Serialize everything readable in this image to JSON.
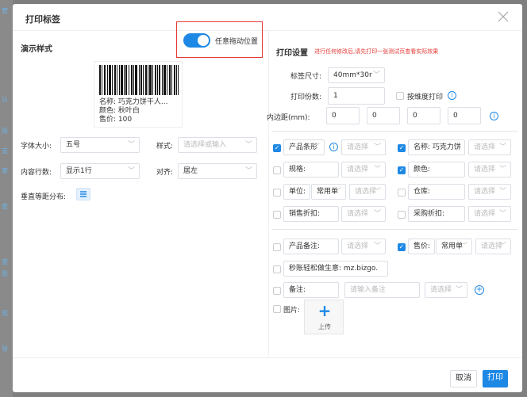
{
  "background_fragments": [
    "管",
    "认",
    "现",
    "支",
    "查",
    "查",
    "查",
    "现",
    "现",
    "导"
  ],
  "dialog": {
    "title": "打印标签",
    "close_icon": "close-icon"
  },
  "preview": {
    "heading": "演示样式",
    "toggle_label": "任意拖动位置",
    "label_lines": [
      "名称: 巧克力饼干人...",
      "颜色: 秋叶白",
      "售价: 100"
    ]
  },
  "left_form": {
    "font_size_label": "字体大小:",
    "font_size_value": "五号",
    "style_label": "样式:",
    "style_placeholder": "请选择或输入",
    "rows_label": "内容行数:",
    "rows_value": "显示1行",
    "align_label": "对齐:",
    "align_value": "居左",
    "vertical_label": "垂直等距分布:"
  },
  "print_settings": {
    "heading": "打印设置",
    "hint": "进行任何修改后,请先打印一张测试页查看实际效果",
    "size_label": "标签尺寸:",
    "size_value": "40mm*30r",
    "copies_label": "打印份数:",
    "copies_value": "1",
    "by_dim_label": "按维度打印",
    "padding_label": "内边距(mm):",
    "padding_values": [
      "0",
      "0",
      "0",
      "0"
    ]
  },
  "fields": {
    "product_barcode": {
      "label": "产品条形",
      "placeholder": "请选择"
    },
    "name": {
      "label": "名称:",
      "value": "巧克力饼",
      "placeholder": "请选择"
    },
    "spec": {
      "label": "规格:",
      "placeholder": "请选择"
    },
    "color": {
      "label": "颜色:",
      "placeholder": "请选择"
    },
    "unit": {
      "label": "单位:",
      "value": "常用单",
      "placeholder": "请选择"
    },
    "warehouse": {
      "label": "仓库:",
      "placeholder": "请选择"
    },
    "sales_discount": {
      "label": "销售折扣:",
      "placeholder": "请选择"
    },
    "purchase_discount": {
      "label": "采购折扣:",
      "placeholder": "请选择"
    },
    "product_note": {
      "label": "产品备注:",
      "placeholder": "请选择"
    },
    "price": {
      "label": "售价:",
      "value": "常用单",
      "placeholder": "请选择"
    },
    "shop_text": "秒账轻松做生意: mz.bizgo.",
    "note": {
      "label": "备注:",
      "placeholder": "请输入备注",
      "select_placeholder": "请选择"
    },
    "image_label": "图片:",
    "upload_label": "上传"
  },
  "footer": {
    "cancel": "取消",
    "print": "打印"
  },
  "colors": {
    "accent": "#1e88e5",
    "hint_red": "#e53935",
    "highlight_border": "#e53935"
  }
}
